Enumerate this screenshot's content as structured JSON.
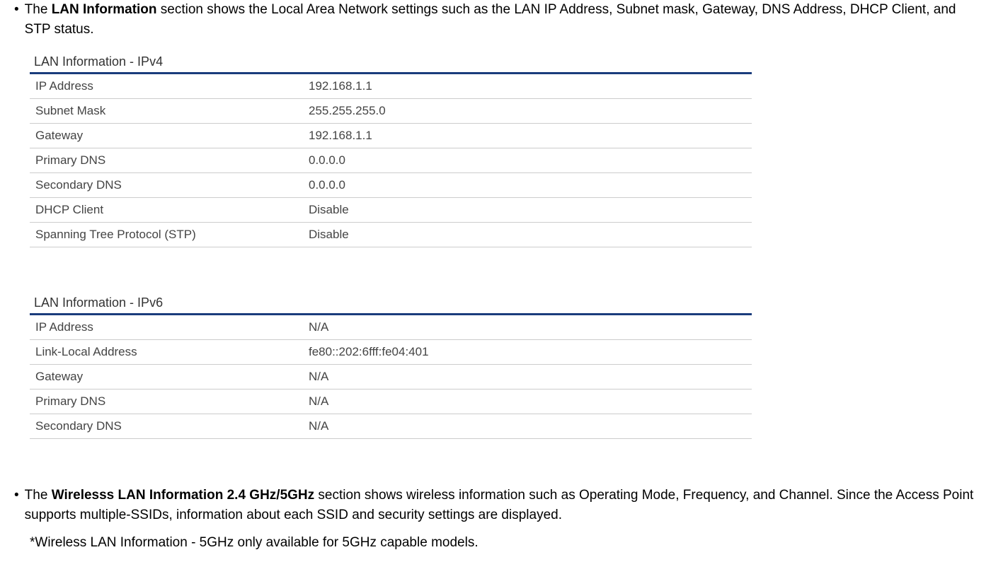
{
  "bullet1": {
    "prefix": "The ",
    "bold": "LAN Information",
    "suffix": " section shows the Local Area Network settings such as the LAN IP Address, Subnet mask, Gateway, DNS Address, DHCP Client, and STP status."
  },
  "ipv4": {
    "title": "LAN Information - IPv4",
    "rows": [
      {
        "label": "IP Address",
        "value": "192.168.1.1"
      },
      {
        "label": "Subnet Mask",
        "value": "255.255.255.0"
      },
      {
        "label": "Gateway",
        "value": "192.168.1.1"
      },
      {
        "label": "Primary DNS",
        "value": "0.0.0.0"
      },
      {
        "label": "Secondary DNS",
        "value": "0.0.0.0"
      },
      {
        "label": "DHCP Client",
        "value": "Disable"
      },
      {
        "label": "Spanning Tree Protocol (STP)",
        "value": "Disable"
      }
    ]
  },
  "ipv6": {
    "title": "LAN Information - IPv6",
    "rows": [
      {
        "label": "IP Address",
        "value": "N/A"
      },
      {
        "label": "Link-Local Address",
        "value": "fe80::202:6fff:fe04:401"
      },
      {
        "label": "Gateway",
        "value": "N/A"
      },
      {
        "label": "Primary DNS",
        "value": "N/A"
      },
      {
        "label": "Secondary DNS",
        "value": "N/A"
      }
    ]
  },
  "bullet2": {
    "prefix": "The ",
    "bold": "Wirelesss LAN Information 2.4 GHz/5GHz",
    "suffix": " section shows wireless information such as Operating Mode, Frequency, and Channel. Since the Access Point supports multiple-SSIDs, information about each SSID and security settings are displayed."
  },
  "note": "*Wireless LAN Information - 5GHz only available for 5GHz capable models."
}
